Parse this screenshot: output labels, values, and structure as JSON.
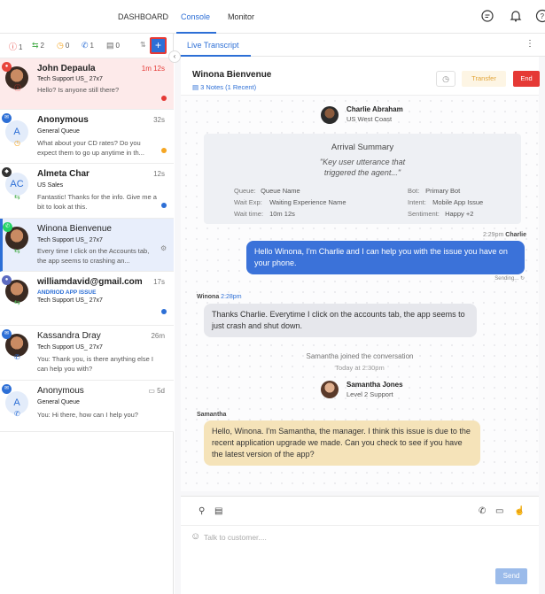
{
  "nav": {
    "dashboard": "DASHBOARD",
    "console": "Console",
    "monitor": "Monitor"
  },
  "counts": [
    {
      "icon": "alert-icon",
      "color": "#e53935",
      "glyph": "ⓘ",
      "value": "1"
    },
    {
      "icon": "sync-icon",
      "color": "#4caf50",
      "glyph": "⇆",
      "value": "2"
    },
    {
      "icon": "clock-icon",
      "color": "#f5a623",
      "glyph": "◷",
      "value": "0"
    },
    {
      "icon": "phone-icon",
      "color": "#2d6fd6",
      "glyph": "✆",
      "value": "1"
    },
    {
      "icon": "document-icon",
      "color": "#666",
      "glyph": "▤",
      "value": "0"
    }
  ],
  "conversations": [
    {
      "name": "John Depaula",
      "time": "1m 12s",
      "queue": "Tech Support US_ 27x7",
      "msg": "Hello? Is anyone still there?"
    },
    {
      "name": "Anonymous",
      "avatar": "A",
      "time": "32s",
      "queue": "General Queue",
      "msg": "What about your CD rates? Do you expect them to go up anytime in th..."
    },
    {
      "name": "Almeta Char",
      "avatar": "AC",
      "time": "12s",
      "queue": "US Sales",
      "msg": "Fantastic! Thanks for the info. Give me a bit to look at this."
    },
    {
      "name": "Winona Bienvenue",
      "time": "",
      "queue": "Tech Support US_ 27x7",
      "msg": "Every time I click on the Accounts tab, the app seems to crashing an..."
    },
    {
      "name": "williamdavid@gmail.com",
      "time": "17s",
      "tags": "ANDRIOD   APP ISSUE",
      "queue": "Tech Support US_ 27x7",
      "msg": ""
    },
    {
      "name": "Kassandra Dray",
      "time": "26m",
      "queue": "Tech Support US_ 27x7",
      "msg": "You: Thank you, is there anything else I can help you with?"
    },
    {
      "name": "Anonymous",
      "avatar": "A",
      "time": "5d",
      "queue": "General Queue",
      "msg": "You: Hi there, how can I help you?"
    }
  ],
  "transcript": {
    "tab": "Live Transcript",
    "customer": "Winona Bienvenue",
    "notes": "3 Notes (1 Recent)",
    "transfer": "Transfer",
    "end": "End",
    "agent1": {
      "name": "Charlie Abraham",
      "sub": "US West Coast"
    },
    "arrival": {
      "title": "Arrival Summary",
      "quote": "\"Key user utterance that triggered the agent...\"",
      "queue_k": "Queue:",
      "queue_v": "Queue Name",
      "wait_exp_k": "Wait Exp:",
      "wait_exp_v": "Waiting Experience Name",
      "wait_time_k": "Wait time:",
      "wait_time_v": "10m 12s",
      "bot_k": "Bot:",
      "bot_v": "Primary Bot",
      "intent_k": "Intent:",
      "intent_v": "Mobile App Issue",
      "sentiment_k": "Sentiment:",
      "sentiment_v": "Happy +2"
    },
    "msg1": {
      "time": "2:29pm",
      "author": "Charlie",
      "text": "Hello Winona, I'm Charlie and I can help you with the issue you have on your phone.",
      "status": "Sending..."
    },
    "msg2": {
      "author": "Winona",
      "time": "2:28pm",
      "text": "Thanks Charlie. Everytime I click on the accounts tab, the app seems to just crash and shut down."
    },
    "joined": "Samantha joined the conversation",
    "joined_time": "Today at 2:30pm",
    "agent2": {
      "name": "Samantha Jones",
      "sub": "Level 2 Support"
    },
    "msg3": {
      "author": "Samantha",
      "text": "Hello, Winona. I'm Samantha, the manager. I think this issue is due to the recent application upgrade we made. Can you check to see if you have the latest version of the app?"
    }
  },
  "composer": {
    "placeholder": "Talk to customer....",
    "send": "Send"
  }
}
